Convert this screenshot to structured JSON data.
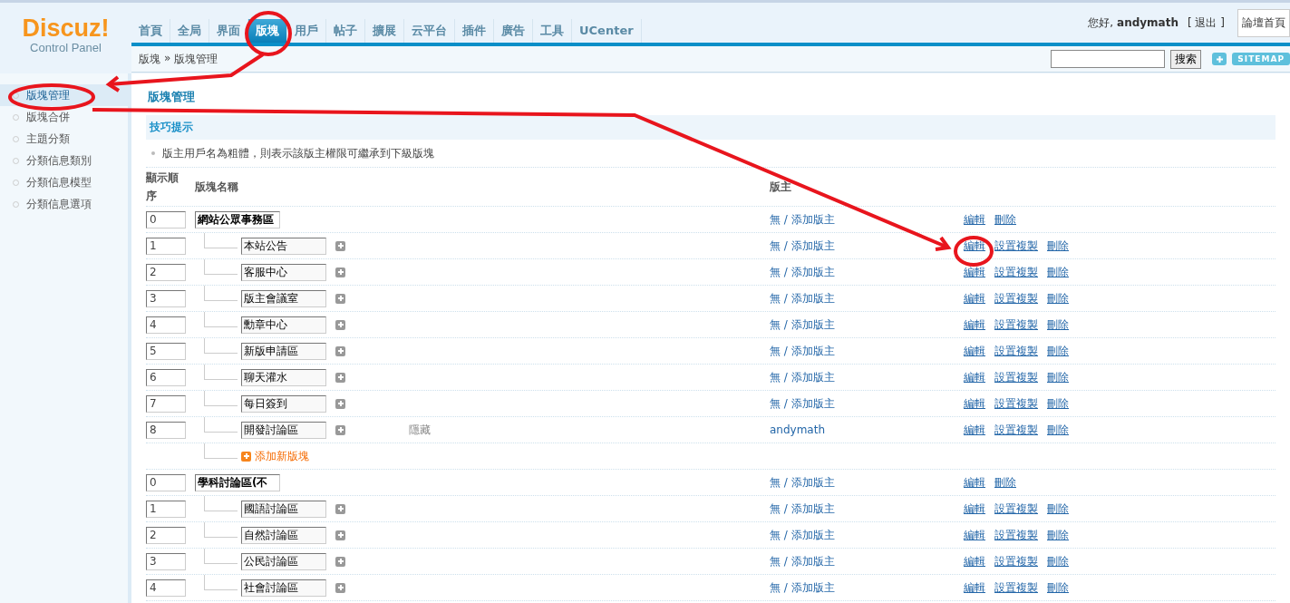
{
  "logo": {
    "title": "Discuz!",
    "subtitle": "Control Panel"
  },
  "nav_tabs": [
    {
      "label": "首頁",
      "selected": false
    },
    {
      "label": "全局",
      "selected": false
    },
    {
      "label": "界面",
      "selected": false
    },
    {
      "label": "版塊",
      "selected": true
    },
    {
      "label": "用戶",
      "selected": false
    },
    {
      "label": "帖子",
      "selected": false
    },
    {
      "label": "擴展",
      "selected": false
    },
    {
      "label": "云平台",
      "selected": false
    },
    {
      "label": "插件",
      "selected": false
    },
    {
      "label": "廣告",
      "selected": false
    },
    {
      "label": "工具",
      "selected": false
    },
    {
      "label": "UCenter",
      "selected": false
    }
  ],
  "user_bar": {
    "greeting": "您好,",
    "username": "andymath",
    "logout": "[ 退出 ]",
    "home_button": "論壇首頁"
  },
  "breadcrumb": [
    "版塊",
    "»",
    "版塊管理"
  ],
  "search": {
    "button": "搜索",
    "sitemap": "SITEMAP"
  },
  "sidebar": {
    "items": [
      {
        "label": "版塊管理",
        "selected": true
      },
      {
        "label": "版塊合併",
        "selected": false
      },
      {
        "label": "主題分類",
        "selected": false
      },
      {
        "label": "分類信息類別",
        "selected": false
      },
      {
        "label": "分類信息模型",
        "selected": false
      },
      {
        "label": "分類信息選項",
        "selected": false
      }
    ]
  },
  "page_title": "版塊管理",
  "tips": {
    "title": "技巧提示",
    "items": [
      "版主用戶名為粗體，則表示該版主權限可繼承到下級版塊"
    ]
  },
  "table": {
    "columns": [
      "顯示順序",
      "版塊名稱",
      "版主"
    ],
    "categories": [
      {
        "order": "0",
        "name": "網站公眾事務區",
        "moderator": "無 / 添加版主",
        "actions": [
          "編輯",
          "刪除"
        ],
        "add_label": "添加新版塊",
        "children": [
          {
            "order": "1",
            "name": "本站公告",
            "moderator": "無 / 添加版主",
            "actions": [
              "編輯",
              "設置複製",
              "刪除"
            ]
          },
          {
            "order": "2",
            "name": "客服中心",
            "moderator": "無 / 添加版主",
            "actions": [
              "編輯",
              "設置複製",
              "刪除"
            ]
          },
          {
            "order": "3",
            "name": "版主會議室",
            "moderator": "無 / 添加版主",
            "actions": [
              "編輯",
              "設置複製",
              "刪除"
            ]
          },
          {
            "order": "4",
            "name": "勳章中心",
            "moderator": "無 / 添加版主",
            "actions": [
              "編輯",
              "設置複製",
              "刪除"
            ]
          },
          {
            "order": "5",
            "name": "新版申請區",
            "moderator": "無 / 添加版主",
            "actions": [
              "編輯",
              "設置複製",
              "刪除"
            ]
          },
          {
            "order": "6",
            "name": "聊天灌水",
            "moderator": "無 / 添加版主",
            "actions": [
              "編輯",
              "設置複製",
              "刪除"
            ]
          },
          {
            "order": "7",
            "name": "每日簽到",
            "moderator": "無 / 添加版主",
            "actions": [
              "編輯",
              "設置複製",
              "刪除"
            ]
          },
          {
            "order": "8",
            "name": "開發討論區",
            "status": "隱藏",
            "moderator": "andymath",
            "actions": [
              "編輯",
              "設置複製",
              "刪除"
            ]
          }
        ]
      },
      {
        "order": "0",
        "name": "學科討論區(不",
        "moderator": "無 / 添加版主",
        "actions": [
          "編輯",
          "刪除"
        ],
        "children": [
          {
            "order": "1",
            "name": "國語討論區",
            "moderator": "無 / 添加版主",
            "actions": [
              "編輯",
              "設置複製",
              "刪除"
            ]
          },
          {
            "order": "2",
            "name": "自然討論區",
            "moderator": "無 / 添加版主",
            "actions": [
              "編輯",
              "設置複製",
              "刪除"
            ]
          },
          {
            "order": "3",
            "name": "公民討論區",
            "moderator": "無 / 添加版主",
            "actions": [
              "編輯",
              "設置複製",
              "刪除"
            ]
          },
          {
            "order": "4",
            "name": "社會討論區",
            "moderator": "無 / 添加版主",
            "actions": [
              "編輯",
              "設置複製",
              "刪除"
            ]
          }
        ]
      }
    ]
  }
}
